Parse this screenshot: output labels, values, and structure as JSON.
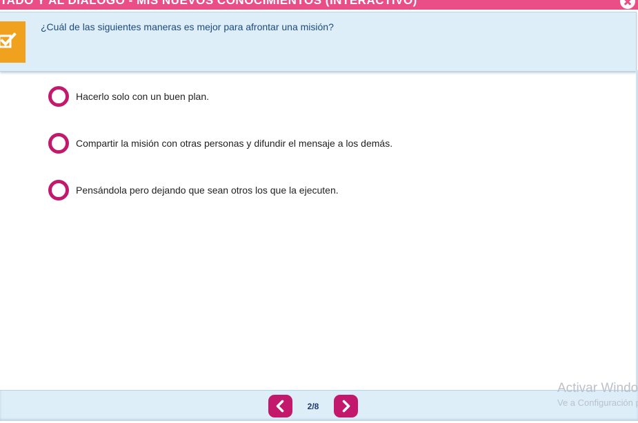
{
  "header": {
    "title": "TADO Y AL DIALOGO - MIS NUEVOS CONOCIMIENTOS (INTERACTIVO)",
    "close_icon": "close-icon"
  },
  "question": {
    "icon": "checkbox-check-icon",
    "text": "¿Cuál de las siguientes maneras es mejor para afrontar una misión?"
  },
  "options": [
    {
      "label": "Hacerlo solo con un buen plan."
    },
    {
      "label": "Compartir la misión con otras personas y difundir el mensaje a los demás."
    },
    {
      "label": "Pensándola pero dejando que sean otros los que la ejecuten."
    }
  ],
  "navigation": {
    "prev_icon": "chevron-left-icon",
    "next_icon": "chevron-right-icon",
    "page_counter": "2/8"
  },
  "watermark": {
    "title": "Activar Windows",
    "subtitle": "Ve a Configuración para activar Windows."
  },
  "colors": {
    "header": "#e94f86",
    "panel": "#ddeef9",
    "accent": "#c2196c",
    "badge": "#f0a21f"
  }
}
